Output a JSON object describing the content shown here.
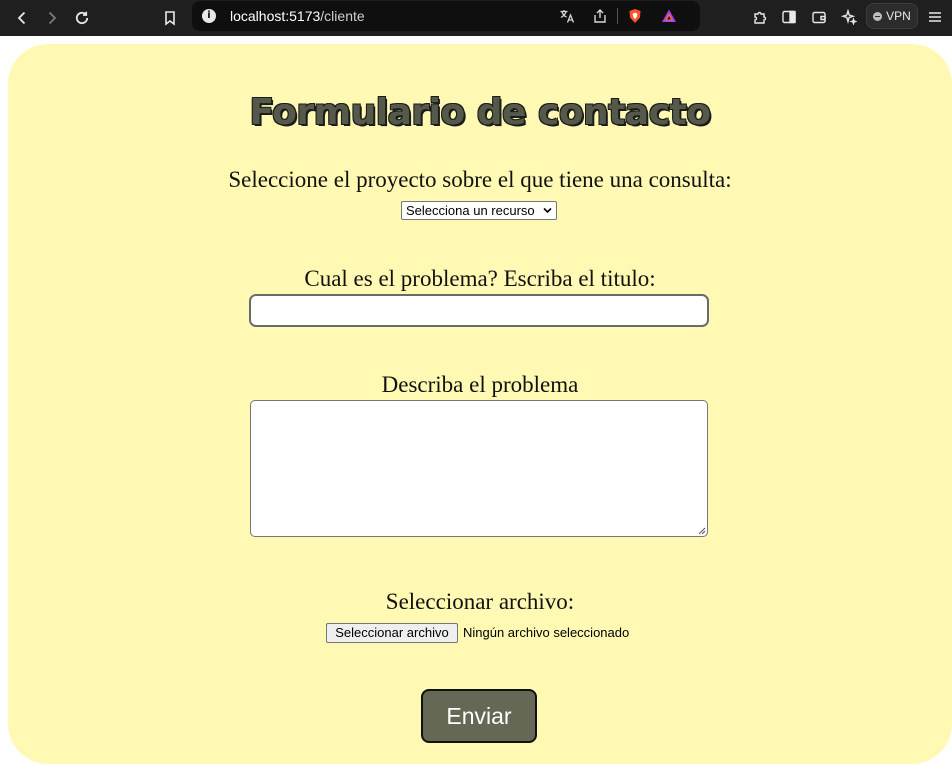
{
  "browser": {
    "url_host": "localhost:5173",
    "url_path": "/cliente",
    "vpn_label": "VPN"
  },
  "form": {
    "title": "Formulario de contacto",
    "project_label": "Seleccione el proyecto sobre el que tiene una consulta:",
    "project_select_value": "Selecciona un recurso",
    "title_field_label": "Cual es el problema? Escriba el titulo:",
    "title_field_value": "",
    "description_label": "Describa el problema",
    "description_value": "",
    "file_label": "Seleccionar archivo:",
    "file_button_label": "Seleccionar archivo",
    "file_status": "Ningún archivo seleccionado",
    "submit_label": "Enviar"
  },
  "colors": {
    "card_background": "#fff9b3",
    "submit_background": "#656854",
    "title_color": "#55594a",
    "chrome_background": "#1f1f1f"
  }
}
